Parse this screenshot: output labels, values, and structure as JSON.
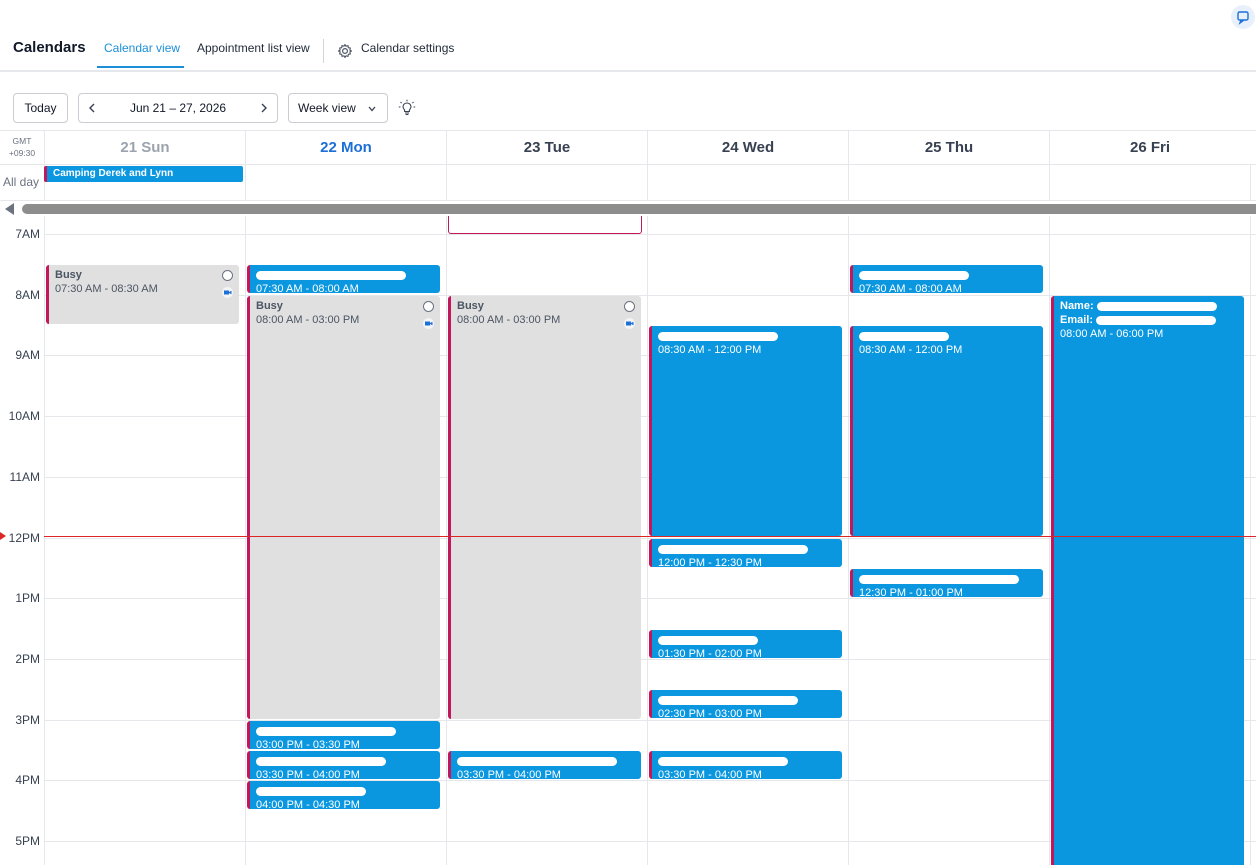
{
  "header": {
    "title": "Calendars",
    "tabs": [
      {
        "label": "Calendar view",
        "active": true
      },
      {
        "label": "Appointment list view",
        "active": false
      }
    ],
    "settings_label": "Calendar settings",
    "settings_icon": "gear-icon"
  },
  "toolbar": {
    "today_label": "Today",
    "date_range": "Jun 21 – 27, 2026",
    "view_label": "Week view",
    "theme_icon": "lightbulb-icon"
  },
  "calendar": {
    "timezone": "GMT\n+09:30",
    "allday_label": "All day",
    "days": [
      {
        "label": "21 Sun",
        "state": "past"
      },
      {
        "label": "22 Mon",
        "state": "today"
      },
      {
        "label": "23 Tue",
        "state": "normal"
      },
      {
        "label": "24 Wed",
        "state": "normal"
      },
      {
        "label": "25 Thu",
        "state": "normal"
      },
      {
        "label": "26 Fri",
        "state": "normal"
      }
    ],
    "allday_events": [
      {
        "day": 0,
        "title": "Camping Derek and Lynn"
      }
    ],
    "hours": [
      "7AM",
      "8AM",
      "9AM",
      "10AM",
      "11AM",
      "12PM",
      "1PM",
      "2PM",
      "3PM",
      "4PM",
      "5PM"
    ],
    "events": [
      {
        "day": 0,
        "title": "Busy",
        "time": "07:30 AM - 08:30 AM",
        "start": 7.5,
        "end": 8.5,
        "kind": "busy"
      },
      {
        "day": 1,
        "title": "",
        "time": "07:30 AM - 08:00 AM",
        "start": 7.5,
        "end": 8.0,
        "kind": "appt"
      },
      {
        "day": 1,
        "title": "Busy",
        "time": "08:00 AM - 03:00 PM",
        "start": 8.0,
        "end": 15.0,
        "kind": "busy"
      },
      {
        "day": 1,
        "title": "",
        "time": "03:00 PM - 03:30 PM",
        "start": 15.0,
        "end": 15.5,
        "kind": "appt"
      },
      {
        "day": 1,
        "title": "",
        "time": "03:30 PM - 04:00 PM",
        "start": 15.5,
        "end": 16.0,
        "kind": "appt"
      },
      {
        "day": 1,
        "title": "",
        "time": "04:00 PM - 04:30 PM",
        "start": 16.0,
        "end": 16.5,
        "kind": "appt"
      },
      {
        "day": 2,
        "title": "Busy",
        "time": "08:00 AM - 03:00 PM",
        "start": 8.0,
        "end": 15.0,
        "kind": "busy"
      },
      {
        "day": 2,
        "title": "",
        "time": "03:30 PM - 04:00 PM",
        "start": 15.5,
        "end": 16.0,
        "kind": "appt"
      },
      {
        "day": 3,
        "title": "",
        "time": "08:30 AM - 12:00 PM",
        "start": 8.5,
        "end": 12.0,
        "kind": "appt"
      },
      {
        "day": 3,
        "title": "",
        "time": "12:00 PM - 12:30 PM",
        "start": 12.0,
        "end": 12.5,
        "kind": "appt"
      },
      {
        "day": 3,
        "title": "",
        "time": "01:30 PM - 02:00 PM",
        "start": 13.5,
        "end": 14.0,
        "kind": "appt"
      },
      {
        "day": 3,
        "title": "",
        "time": "02:30 PM - 03:00 PM",
        "start": 14.5,
        "end": 15.0,
        "kind": "appt"
      },
      {
        "day": 3,
        "title": "",
        "time": "03:30 PM - 04:00 PM",
        "start": 15.5,
        "end": 16.0,
        "kind": "appt"
      },
      {
        "day": 4,
        "title": "",
        "time": "07:30 AM - 08:00 AM",
        "start": 7.5,
        "end": 8.0,
        "kind": "appt"
      },
      {
        "day": 4,
        "title": "",
        "time": "08:30 AM - 12:00 PM",
        "start": 8.5,
        "end": 12.0,
        "kind": "appt"
      },
      {
        "day": 4,
        "title": "",
        "time": "12:30 PM - 01:00 PM",
        "start": 12.5,
        "end": 13.0,
        "kind": "appt"
      },
      {
        "day": 5,
        "title": "Name:",
        "line2": "Email:",
        "time": "08:00 AM - 06:00 PM",
        "start": 8.0,
        "end": 18.0,
        "kind": "appt"
      }
    ],
    "now": 11.97
  }
}
